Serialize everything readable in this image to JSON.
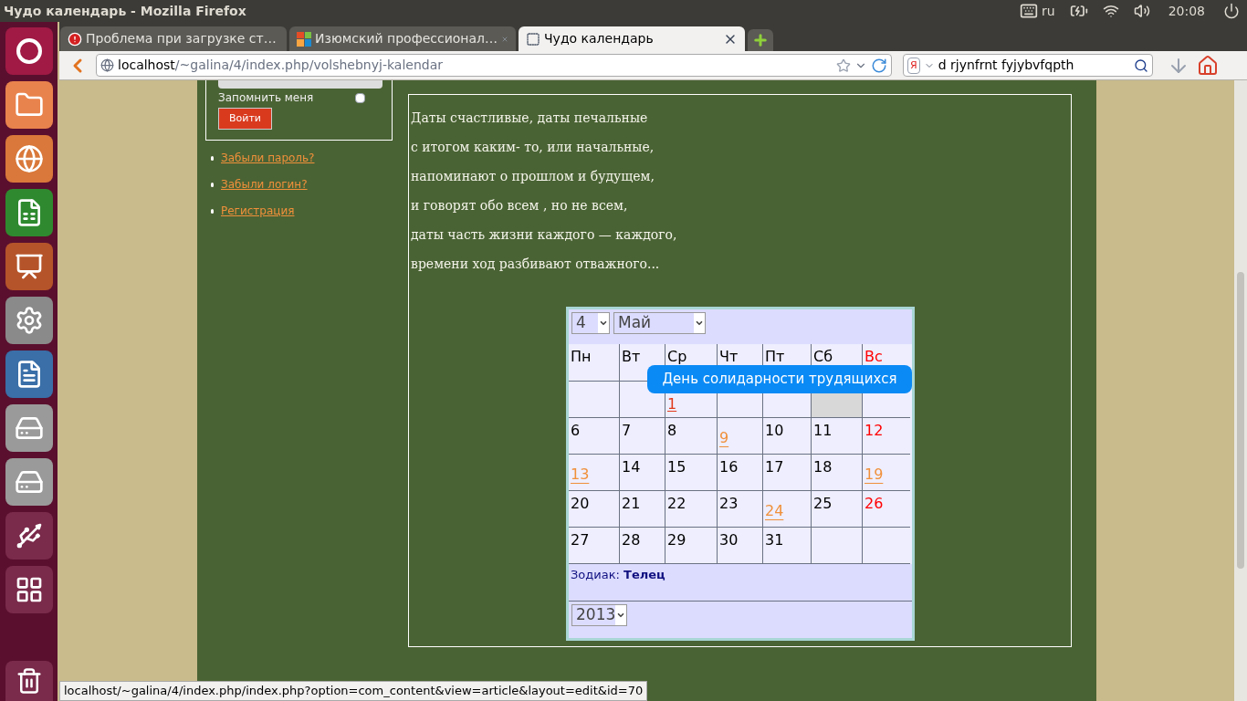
{
  "top_bar": {
    "window_title": "Чудо календарь - Mozilla Firefox",
    "keyboard_layout": "ru",
    "clock": "20:08"
  },
  "tabs": [
    {
      "label": "Проблема при загрузке ст…",
      "kind": "error",
      "selected": false
    },
    {
      "label": "Изюмский профессионал…",
      "kind": "cms",
      "selected": false
    },
    {
      "label": "Чудо календарь",
      "kind": "blank",
      "selected": true
    }
  ],
  "nav": {
    "url_host": "localhost",
    "url_path": "/~galina/4/index.php/volshebnyj-kalendar",
    "search_engine_badge": "Я",
    "search_value": "d rjynfrnt fyjybvfqpth"
  },
  "login": {
    "remember_label": "Запомнить меня",
    "remember_checked": false,
    "submit": "Войти"
  },
  "links": [
    "Забыли пароль?",
    "Забыли логин?",
    "Регистрация"
  ],
  "poem": [
    "Даты счастливые, даты печальные",
    "с итогом каким- то, или начальные,",
    "напоминают о прошлом и будущем,",
    "и говорят обо всем , но не всем,",
    "даты часть жизни каждого — каждого,",
    "времени ход разбивают отважного..."
  ],
  "calendar": {
    "day_select": "4",
    "month_select": "Май",
    "year_select": "2013",
    "weekdays": [
      {
        "label": "Пн",
        "weekend": false
      },
      {
        "label": "Вт",
        "weekend": false
      },
      {
        "label": "Ср",
        "weekend": false
      },
      {
        "label": "Чт",
        "weekend": false
      },
      {
        "label": "Пт",
        "weekend": false
      },
      {
        "label": "Сб",
        "weekend": false
      },
      {
        "label": "Вс",
        "weekend": true
      }
    ],
    "weeks": [
      [
        {
          "kind": "empty"
        },
        {
          "kind": "empty"
        },
        {
          "day": "1",
          "kind": "holiday_red",
          "selected": false
        },
        {
          "kind": "covered",
          "selected": false
        },
        {
          "kind": "covered",
          "selected": false
        },
        {
          "kind": "covered",
          "selected": true
        },
        {
          "kind": "covered",
          "selected": false
        }
      ],
      [
        {
          "day": "6",
          "kind": "plain",
          "selected": false
        },
        {
          "day": "7",
          "kind": "plain",
          "selected": false
        },
        {
          "day": "8",
          "kind": "plain",
          "selected": false
        },
        {
          "day": "9",
          "kind": "holiday",
          "selected": false
        },
        {
          "day": "10",
          "kind": "plain",
          "selected": false
        },
        {
          "day": "11",
          "kind": "plain",
          "selected": false
        },
        {
          "day": "12",
          "kind": "weekend",
          "selected": false
        }
      ],
      [
        {
          "day": "13",
          "kind": "holiday",
          "selected": false
        },
        {
          "day": "14",
          "kind": "plain",
          "selected": false
        },
        {
          "day": "15",
          "kind": "plain",
          "selected": false
        },
        {
          "day": "16",
          "kind": "plain",
          "selected": false
        },
        {
          "day": "17",
          "kind": "plain",
          "selected": false
        },
        {
          "day": "18",
          "kind": "plain",
          "selected": false
        },
        {
          "day": "19",
          "kind": "holiday",
          "selected": false
        }
      ],
      [
        {
          "day": "20",
          "kind": "plain",
          "selected": false
        },
        {
          "day": "21",
          "kind": "plain",
          "selected": false
        },
        {
          "day": "22",
          "kind": "plain",
          "selected": false
        },
        {
          "day": "23",
          "kind": "plain",
          "selected": false
        },
        {
          "day": "24",
          "kind": "holiday",
          "selected": false
        },
        {
          "day": "25",
          "kind": "plain",
          "selected": false
        },
        {
          "day": "26",
          "kind": "weekend",
          "selected": false
        }
      ],
      [
        {
          "day": "27",
          "kind": "plain",
          "selected": false
        },
        {
          "day": "28",
          "kind": "plain",
          "selected": false
        },
        {
          "day": "29",
          "kind": "plain",
          "selected": false
        },
        {
          "day": "30",
          "kind": "plain",
          "selected": false
        },
        {
          "day": "31",
          "kind": "plain",
          "selected": false
        },
        {
          "kind": "empty"
        },
        {
          "kind": "empty"
        }
      ]
    ],
    "zodiac_label": "Зодиак:",
    "zodiac_sign": "Телец",
    "tooltip": "День солидарности трудящихся"
  },
  "status_url": "localhost/~galina/4/index.php/index.php?option=com_content&view=article&layout=edit&id=70"
}
